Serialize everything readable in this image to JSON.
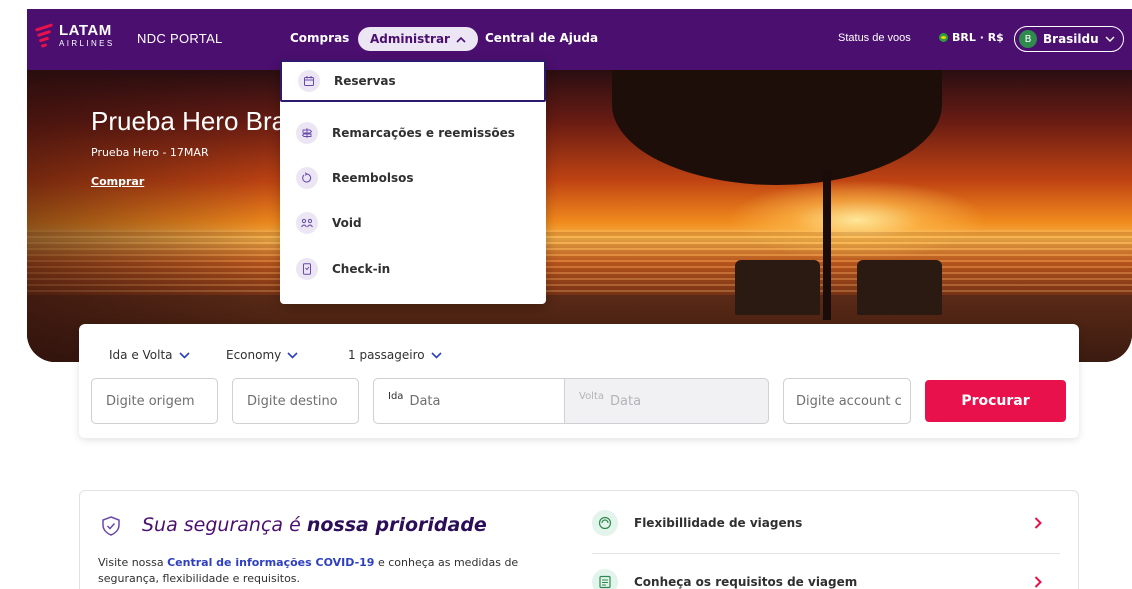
{
  "brand": {
    "name": "LATAM",
    "sub": "AIRLINES",
    "portal": "NDC PORTAL"
  },
  "nav": {
    "compras": "Compras",
    "administrar": "Administrar",
    "ajuda": "Central de Ajuda",
    "status": "Status de voos",
    "currency": "BRL · R$",
    "user_initial": "B",
    "user_name": "Brasildu"
  },
  "hero": {
    "title": "Prueba Hero Brasil",
    "subtitle": "Prueba Hero - 17MAR",
    "cta": "Comprar"
  },
  "dropdown": {
    "items": [
      {
        "label": "Reservas",
        "icon": "calendar-icon"
      },
      {
        "label": "Remarcações e reemissões",
        "icon": "signpost-icon"
      },
      {
        "label": "Reembolsos",
        "icon": "refund-icon"
      },
      {
        "label": "Void",
        "icon": "people-icon"
      },
      {
        "label": "Check-in",
        "icon": "phone-icon"
      }
    ]
  },
  "search": {
    "trip_type": "Ida e Volta",
    "cabin": "Economy",
    "passengers": "1 passageiro",
    "origin_placeholder": "Digite origem",
    "destination_placeholder": "Digite destino",
    "ida_label": "Ida",
    "ida_placeholder": "Data",
    "volta_label": "Volta",
    "volta_placeholder": "Data",
    "account_placeholder": "Digite account c",
    "submit": "Procurar"
  },
  "info": {
    "title_plain": "Sua segurança é ",
    "title_bold": "nossa prioridade",
    "desc_pre": "Visite nossa ",
    "desc_link": "Central de informações COVID-19",
    "desc_post": " e conheça as medidas de segurança, flexibilidade e requisitos.",
    "items": [
      {
        "label": "Flexibillidade de viagens"
      },
      {
        "label": "Conheça os requisitos de viagem"
      }
    ]
  },
  "colors": {
    "brand_purple": "#4b0f6f",
    "accent_red": "#e8114b",
    "link_blue": "#2d3fbf"
  }
}
